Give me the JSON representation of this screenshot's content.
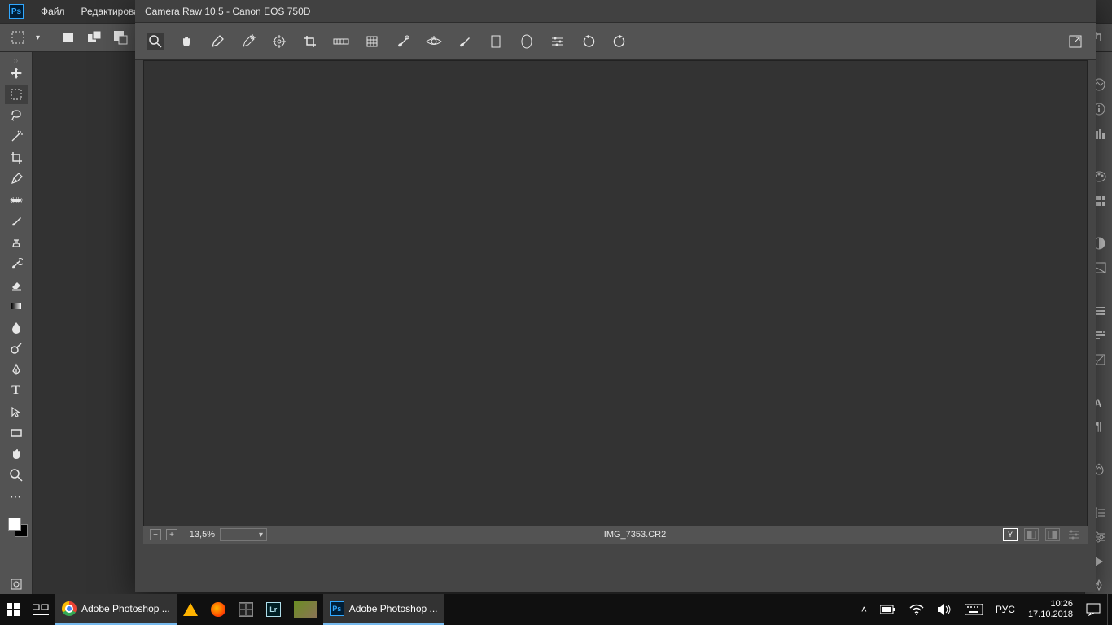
{
  "photoshop": {
    "menu": {
      "file": "Файл",
      "edit": "Редактирован"
    },
    "tools": [
      "move",
      "marquee",
      "lasso",
      "magic-wand",
      "crop",
      "eyedropper",
      "spot-heal",
      "brush",
      "clone",
      "history-brush",
      "eraser",
      "gradient",
      "blur",
      "dodge",
      "pen",
      "type",
      "path-select",
      "rectangle",
      "hand",
      "zoom",
      "more"
    ],
    "right_panels": [
      "learn",
      "info",
      "histogram",
      "swatches",
      "color",
      "pattern",
      "lens",
      "hue",
      "arrange",
      "brushes",
      "brush-settings",
      "history",
      "paragraph",
      "character",
      "libraries",
      "adjustments",
      "layers",
      "channels",
      "paths",
      "actions",
      "styles"
    ]
  },
  "camera_raw": {
    "title": "Camera Raw 10.5  -  Canon EOS 750D",
    "tools": [
      "zoom",
      "hand",
      "white-balance",
      "color-sampler",
      "target",
      "crop",
      "straighten",
      "transform",
      "spot-removal",
      "red-eye",
      "adjustment-brush",
      "graduated-filter",
      "radial-filter",
      "preferences",
      "rotate-ccw",
      "rotate-cw"
    ],
    "fullscreen_label": "Fullscreen",
    "zoom": "13,5%",
    "filename": "IMG_7353.CR2",
    "shadow_clip": "Y"
  },
  "taskbar": {
    "chrome_title": "Adobe Photoshop ...",
    "ps_title": "Adobe Photoshop ...",
    "lang": "РУС",
    "time": "10:26",
    "date": "17.10.2018"
  }
}
